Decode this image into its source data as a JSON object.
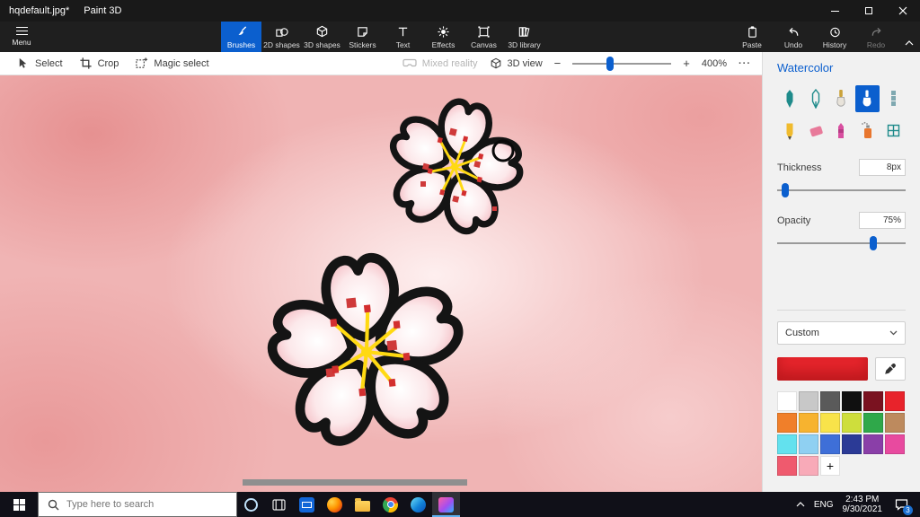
{
  "window": {
    "title_file": "hqdefault.jpg*",
    "title_app": "Paint 3D"
  },
  "menu": {
    "menu_label": "Menu",
    "tabs": [
      {
        "label": "Brushes"
      },
      {
        "label": "2D shapes"
      },
      {
        "label": "3D shapes"
      },
      {
        "label": "Stickers"
      },
      {
        "label": "Text"
      },
      {
        "label": "Effects"
      },
      {
        "label": "Canvas"
      },
      {
        "label": "3D library"
      }
    ],
    "paste_label": "Paste",
    "undo_label": "Undo",
    "history_label": "History",
    "redo_label": "Redo"
  },
  "toolbar": {
    "select_label": "Select",
    "crop_label": "Crop",
    "magic_select_label": "Magic select",
    "mixed_reality_label": "Mixed reality",
    "view3d_label": "3D view",
    "zoom_out_label": "−",
    "zoom_in_label": "+",
    "zoom_value": "400%",
    "zoom_percent": 38,
    "more_label": "···"
  },
  "panel": {
    "title": "Watercolor",
    "brushes": [
      "Marker",
      "Calligraphy pen",
      "Oil brush",
      "Watercolor",
      "Pixel pen",
      "Pencil",
      "Eraser",
      "Crayon",
      "Spray can",
      "Pixel eraser"
    ],
    "selected_brush": "Watercolor",
    "thickness_label": "Thickness",
    "thickness_value": "8px",
    "thickness_percent": 6,
    "opacity_label": "Opacity",
    "opacity_value": "75%",
    "opacity_percent": 75,
    "custom_label": "Custom",
    "current_color": "#e8252c",
    "palette": [
      "#ffffff",
      "#c8c8c8",
      "#5a5a5a",
      "#101010",
      "#7a1220",
      "#e8232b",
      "#f07f2a",
      "#f7b32f",
      "#f8e34a",
      "#cede3c",
      "#2fa84a",
      "#bd8a5e",
      "#63e1ee",
      "#8fd0f2",
      "#3e6fd8",
      "#2b3a96",
      "#8a3fa8",
      "#e84a9f",
      "#ef5a6e",
      "#f8aab8"
    ],
    "add_color_label": "+"
  },
  "taskbar": {
    "search_placeholder": "Type here to search",
    "language": "ENG",
    "time": "2:43 PM",
    "date": "9/30/2021",
    "badge": "3"
  }
}
